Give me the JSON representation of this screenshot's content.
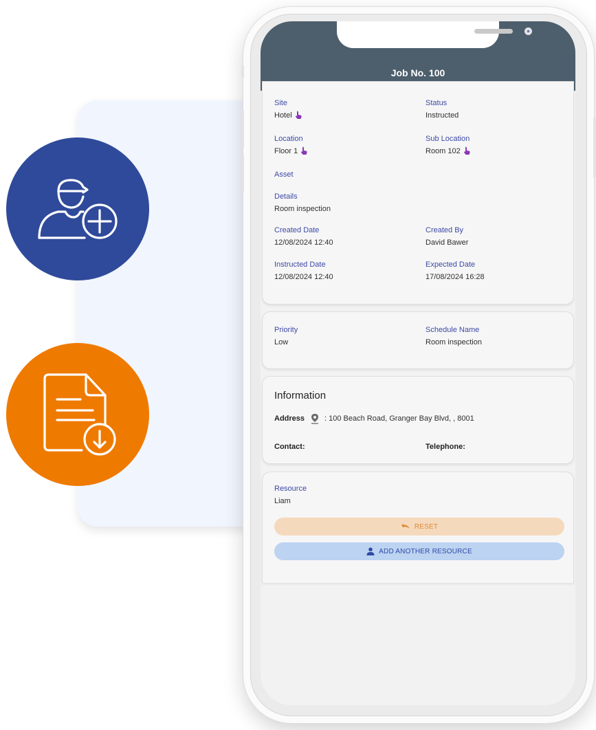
{
  "colors": {
    "header": "#4d5e6c",
    "label": "#3d4aa6",
    "blue_badge": "#2f4a9a",
    "orange_badge": "#ef7a00",
    "pin_purple": "#8a37b8",
    "reset_bg": "#f5d9bc",
    "add_bg": "#bcd3f1"
  },
  "feature_icons": [
    "add-user-icon",
    "document-download-icon"
  ],
  "header": {
    "title": "Job No. 100"
  },
  "job": {
    "site_label": "Site",
    "site_value": "Hotel",
    "status_label": "Status",
    "status_value": "Instructed",
    "location_label": "Location",
    "location_value": "Floor 1",
    "sublocation_label": "Sub Location",
    "sublocation_value": "Room 102",
    "asset_label": "Asset",
    "details_label": "Details",
    "details_value": "Room inspection",
    "created_date_label": "Created Date",
    "created_date_value": "12/08/2024 12:40",
    "created_by_label": "Created By",
    "created_by_value": "David Bawer",
    "instructed_date_label": "Instructed Date",
    "instructed_date_value": "12/08/2024 12:40",
    "expected_date_label": "Expected Date",
    "expected_date_value": "17/08/2024 16:28"
  },
  "schedule": {
    "priority_label": "Priority",
    "priority_value": "Low",
    "schedule_name_label": "Schedule Name",
    "schedule_name_value": "Room inspection"
  },
  "information": {
    "title": "Information",
    "address_label": "Address",
    "address_value": ": 100 Beach Road, Granger Bay Blvd, , 8001",
    "contact_label": "Contact:",
    "telephone_label": "Telephone:"
  },
  "resource": {
    "label": "Resource",
    "value": "Liam",
    "reset_label": "RESET",
    "add_label": "ADD ANOTHER RESOURCE"
  }
}
